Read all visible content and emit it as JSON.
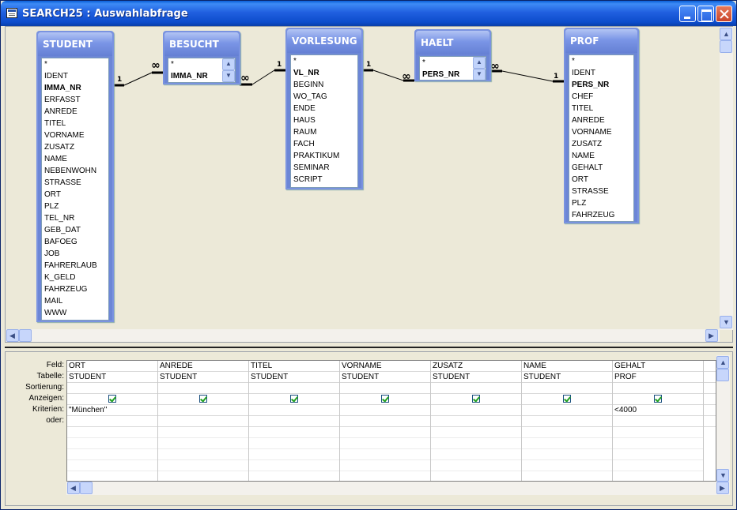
{
  "window": {
    "title": "SEARCH25 : Auswahlabfrage"
  },
  "diagram": {
    "tables": [
      {
        "id": "student",
        "name": "STUDENT",
        "fields": [
          "*",
          "IDENT",
          "IMMA_NR",
          "ERFASST",
          "ANREDE",
          "TITEL",
          "VORNAME",
          "ZUSATZ",
          "NAME",
          "NEBENWOHN",
          "STRASSE",
          "ORT",
          "PLZ",
          "TEL_NR",
          "GEB_DAT",
          "BAFOEG",
          "JOB",
          "FAHRERLAUB",
          "K_GELD",
          "FAHRZEUG",
          "MAIL",
          "WWW"
        ],
        "key_fields": [
          "IMMA_NR"
        ]
      },
      {
        "id": "besucht",
        "name": "BESUCHT",
        "fields": [
          "*",
          "IMMA_NR"
        ],
        "key_fields": [
          "IMMA_NR"
        ]
      },
      {
        "id": "vorlesung",
        "name": "VORLESUNG",
        "fields": [
          "*",
          "VL_NR",
          "BEGINN",
          "WO_TAG",
          "ENDE",
          "HAUS",
          "RAUM",
          "FACH",
          "PRAKTIKUM",
          "SEMINAR",
          "SCRIPT"
        ],
        "key_fields": [
          "VL_NR"
        ]
      },
      {
        "id": "haelt",
        "name": "HAELT",
        "fields": [
          "*",
          "PERS_NR"
        ],
        "key_fields": [
          "PERS_NR"
        ]
      },
      {
        "id": "prof",
        "name": "PROF",
        "fields": [
          "*",
          "IDENT",
          "PERS_NR",
          "CHEF",
          "TITEL",
          "ANREDE",
          "VORNAME",
          "ZUSATZ",
          "NAME",
          "GEHALT",
          "ORT",
          "STRASSE",
          "PLZ",
          "FAHRZEUG"
        ],
        "key_fields": [
          "PERS_NR"
        ]
      }
    ],
    "relationships": [
      {
        "one": "1",
        "many": "∞"
      },
      {
        "one": "1",
        "many": "∞"
      },
      {
        "one": "1",
        "many": "∞"
      },
      {
        "one": "1",
        "many": "∞"
      }
    ],
    "line_color": "#000000"
  },
  "query_grid": {
    "row_labels": [
      "Feld:",
      "Tabelle:",
      "Sortierung:",
      "Anzeigen:",
      "Kriterien:",
      "oder:"
    ],
    "columns": [
      {
        "feld": "ORT",
        "tabelle": "STUDENT",
        "sortierung": "",
        "anzeigen": true,
        "kriterien": "\"München\"",
        "oder": ""
      },
      {
        "feld": "ANREDE",
        "tabelle": "STUDENT",
        "sortierung": "",
        "anzeigen": true,
        "kriterien": "",
        "oder": ""
      },
      {
        "feld": "TITEL",
        "tabelle": "STUDENT",
        "sortierung": "",
        "anzeigen": true,
        "kriterien": "",
        "oder": ""
      },
      {
        "feld": "VORNAME",
        "tabelle": "STUDENT",
        "sortierung": "",
        "anzeigen": true,
        "kriterien": "",
        "oder": ""
      },
      {
        "feld": "ZUSATZ",
        "tabelle": "STUDENT",
        "sortierung": "",
        "anzeigen": true,
        "kriterien": "",
        "oder": ""
      },
      {
        "feld": "NAME",
        "tabelle": "STUDENT",
        "sortierung": "",
        "anzeigen": true,
        "kriterien": "",
        "oder": ""
      },
      {
        "feld": "GEHALT",
        "tabelle": "PROF",
        "sortierung": "",
        "anzeigen": true,
        "kriterien": "<4000",
        "oder": ""
      }
    ],
    "blank_rows": 6
  },
  "icons": {
    "scroll_up": "▲",
    "scroll_down": "▼",
    "scroll_left": "◀",
    "scroll_right": "▶"
  },
  "colors": {
    "titlebar": "#2160e0",
    "table_header": "#6c86d6",
    "checkmark": "#21a121"
  }
}
